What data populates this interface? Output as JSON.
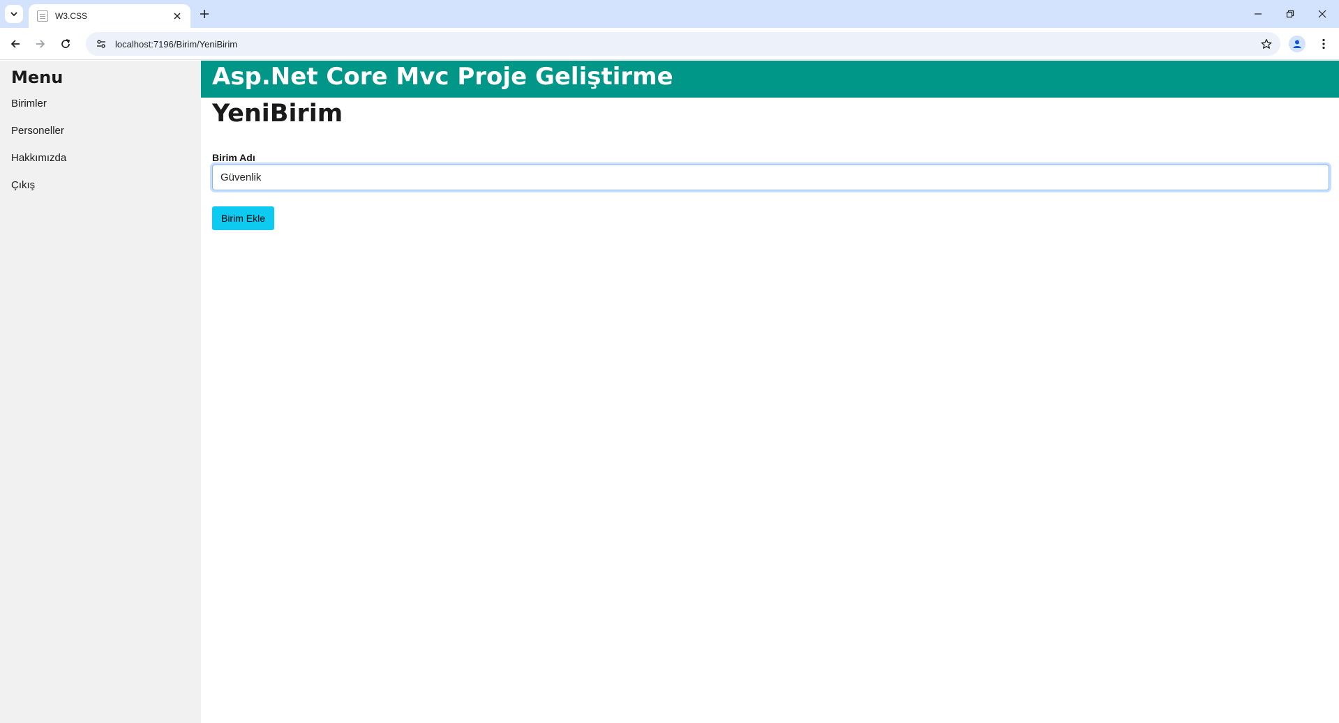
{
  "browser": {
    "tab": {
      "title": "W3.CSS"
    },
    "address_bar": {
      "url": "localhost:7196/Birim/YeniBirim"
    }
  },
  "sidebar": {
    "heading": "Menu",
    "items": [
      {
        "label": "Birimler"
      },
      {
        "label": "Personeller"
      },
      {
        "label": "Hakkımızda"
      },
      {
        "label": "Çıkış"
      }
    ]
  },
  "header": {
    "title": "Asp.Net Core Mvc Proje Geliştirme"
  },
  "main": {
    "page_title": "YeniBirim",
    "form": {
      "field_label": "Birim Adı",
      "field_value": "Güvenlik",
      "submit_label": "Birim Ekle"
    }
  },
  "colors": {
    "tabstrip": "#d3e3fd",
    "header_bar": "#009688",
    "sidebar": "#f1f1f1",
    "submit_button": "#0dcaf0"
  }
}
